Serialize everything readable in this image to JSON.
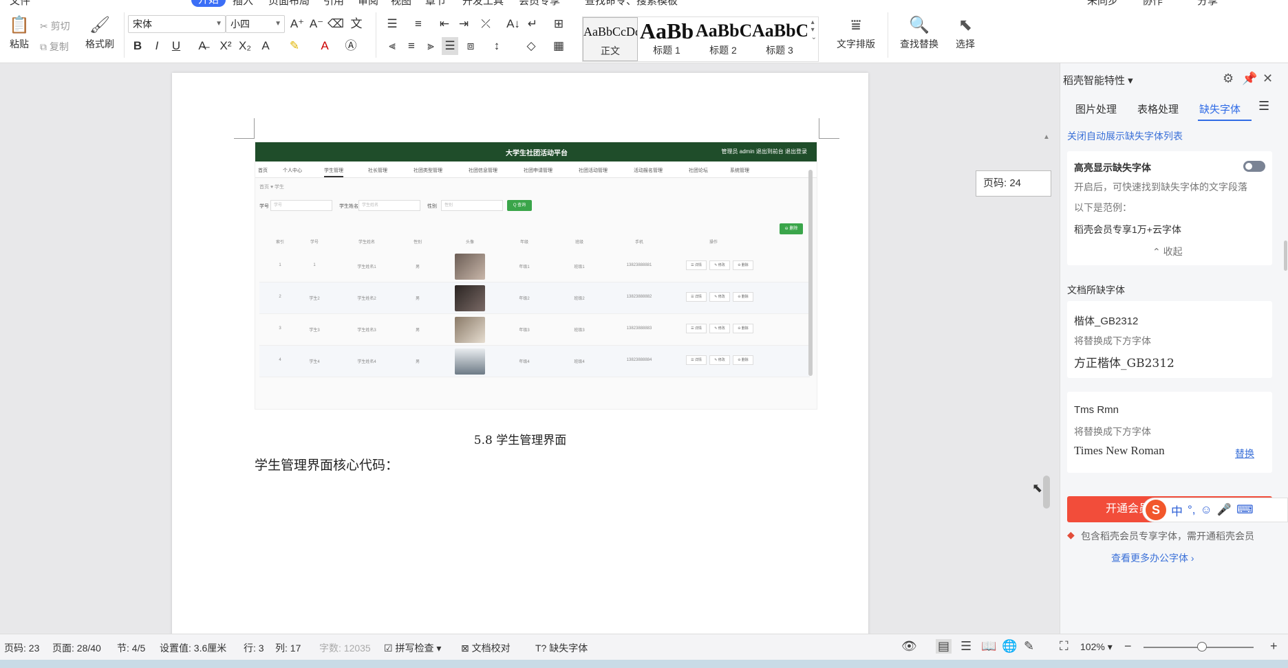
{
  "menubar": {
    "items": [
      "文件",
      "开始",
      "插入",
      "页面布局",
      "引用",
      "审阅",
      "视图",
      "章节",
      "开发工具",
      "会员专享",
      "查找命令、搜索模板"
    ],
    "right": [
      "未同步",
      "协作",
      "分享"
    ]
  },
  "ribbon": {
    "paste": "粘贴",
    "cut": "剪切",
    "copy": "复制",
    "format_painter": "格式刷",
    "font_name": "宋体",
    "font_size": "小四",
    "styles": [
      {
        "preview": "AaBbCcDd",
        "name": "正文"
      },
      {
        "preview": "AaBb",
        "name": "标题 1"
      },
      {
        "preview": "AaBbC",
        "name": "标题 2"
      },
      {
        "preview": "AaBbC",
        "name": "标题 3"
      }
    ],
    "text_layout": "文字排版",
    "find_replace": "查找替换",
    "select": "选择"
  },
  "document": {
    "caption": "5.8  学生管理界面",
    "body_line": "学生管理界面核心代码：",
    "page_tooltip": "页码: 24"
  },
  "screenshot": {
    "title": "大学生社团活动平台",
    "user": "管理员 admin    退出到前台    退出登录",
    "nav": [
      "首页",
      "个人中心",
      "学生管理",
      "社长管理",
      "社团类型管理",
      "社团信息管理",
      "社团申请管理",
      "社团活动管理",
      "活动报名管理",
      "社团论坛",
      "系统管理"
    ],
    "crumb": "首页 ♥ 学生",
    "search_labels": [
      "学号",
      "学生姓名",
      "性别"
    ],
    "search_placeholders": [
      "学号",
      "学生姓名",
      "性别"
    ],
    "search_button": "Q 查询",
    "delete_button": "⊖ 删除",
    "headers": [
      "索引",
      "学号",
      "学生姓名",
      "性别",
      "头像",
      "年级",
      "班级",
      "手机",
      "操作"
    ],
    "rows": [
      {
        "idx": "1",
        "id": "1",
        "name": "学生姓名1",
        "sex": "男",
        "grade": "年级1",
        "cls": "班级1",
        "phone": "13823888881"
      },
      {
        "idx": "2",
        "id": "学生2",
        "name": "学生姓名2",
        "sex": "男",
        "grade": "年级2",
        "cls": "班级2",
        "phone": "13823888882"
      },
      {
        "idx": "3",
        "id": "学生3",
        "name": "学生姓名3",
        "sex": "男",
        "grade": "年级3",
        "cls": "班级3",
        "phone": "13823888883"
      },
      {
        "idx": "4",
        "id": "学生4",
        "name": "学生姓名4",
        "sex": "男",
        "grade": "年级4",
        "cls": "班级4",
        "phone": "13823888884"
      }
    ],
    "actions": [
      "☰ 详情",
      "✎ 修改",
      "⊖ 删除"
    ]
  },
  "panel": {
    "title": "稻壳智能特性",
    "tabs": [
      "图片处理",
      "表格处理",
      "缺失字体"
    ],
    "close_auto_link": "关闭自动展示缺失字体列表",
    "highlight_title": "高亮显示缺失字体",
    "highlight_desc": "开启后，可快速找到缺失字体的文字段落",
    "example_label": "以下是范例：",
    "example_text": "稻壳会员专享1万+云字体",
    "collapse": "收起",
    "missing_title": "文档所缺字体",
    "fonts": [
      {
        "name": "楷体_GB2312",
        "hint": "将替换成下方字体",
        "replacement": "方正楷体_GB2312",
        "action": ""
      },
      {
        "name": "Tms Rmn",
        "hint": "将替换成下方字体",
        "replacement": "Times New Roman",
        "action": "替换"
      }
    ],
    "open_button": "开通会员",
    "member_note": "包含稻壳会员专享字体，需开通稻壳会员",
    "more_link": "查看更多办公字体 ›",
    "ime": [
      "中",
      "°,",
      "☺",
      "🎤",
      "⌨"
    ]
  },
  "status": {
    "page_no": "页码: 23",
    "pages": "页面: 28/40",
    "section": "节: 4/5",
    "setting": "设置值: 3.6厘米",
    "row": "行: 3",
    "col": "列: 17",
    "words": "字数: 12035",
    "spell": "拼写检查",
    "proof": "文档校对",
    "missing_font": "缺失字体",
    "zoom": "102%"
  }
}
